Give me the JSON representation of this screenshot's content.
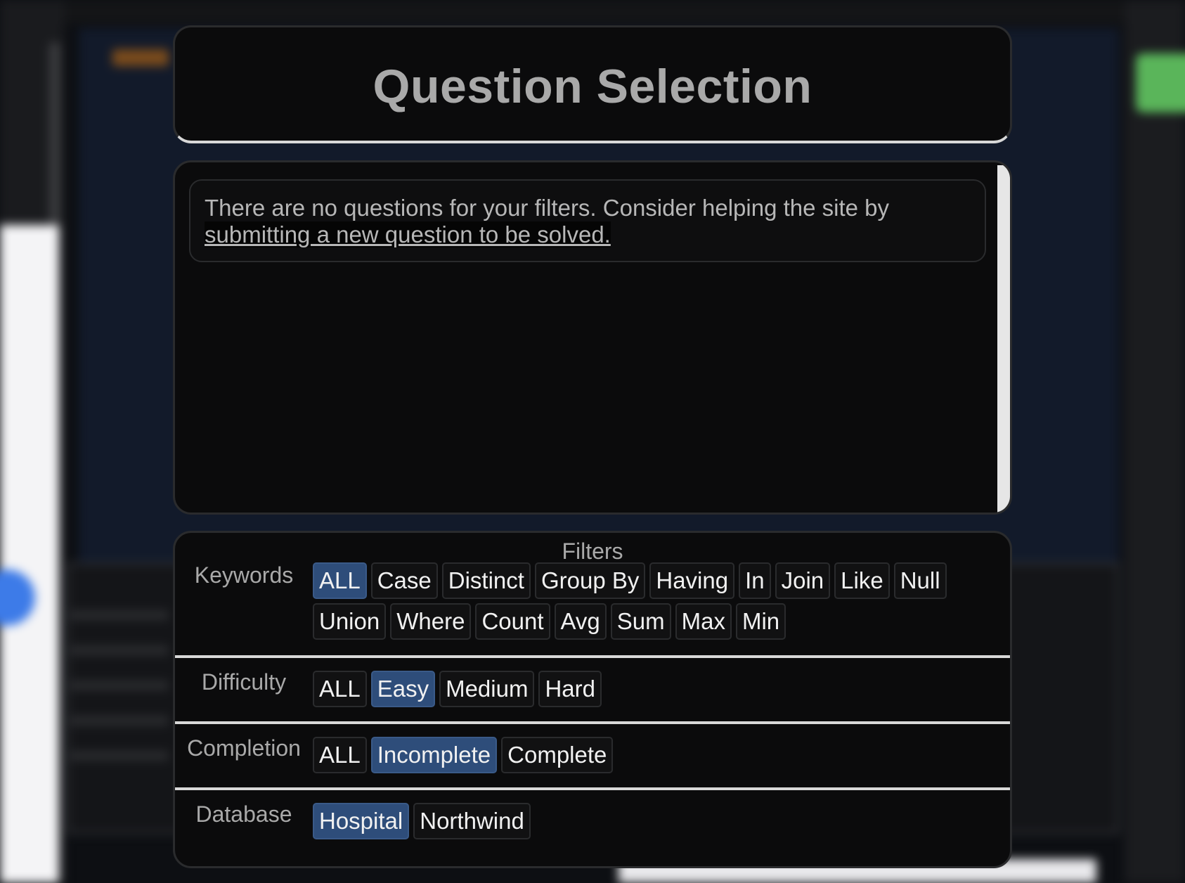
{
  "modal": {
    "title": "Question Selection",
    "empty_message": "There are no questions for your filters. Consider helping the site by",
    "empty_link": "submitting a new question to be solved."
  },
  "filters": {
    "heading": "Filters",
    "keywords": {
      "label": "Keywords",
      "options": [
        "ALL",
        "Case",
        "Distinct",
        "Group By",
        "Having",
        "In",
        "Join",
        "Like",
        "Null",
        "Union",
        "Where",
        "Count",
        "Avg",
        "Sum",
        "Max",
        "Min"
      ],
      "selected": "ALL"
    },
    "difficulty": {
      "label": "Difficulty",
      "options": [
        "ALL",
        "Easy",
        "Medium",
        "Hard"
      ],
      "selected": "Easy"
    },
    "completion": {
      "label": "Completion",
      "options": [
        "ALL",
        "Incomplete",
        "Complete"
      ],
      "selected": "Incomplete"
    },
    "database": {
      "label": "Database",
      "options": [
        "Hospital",
        "Northwind"
      ],
      "selected": "Hospital"
    }
  },
  "colors": {
    "chip_active": "#2e4d7a",
    "card_bg": "#0b0b0c",
    "separator": "#d8d8d8"
  }
}
